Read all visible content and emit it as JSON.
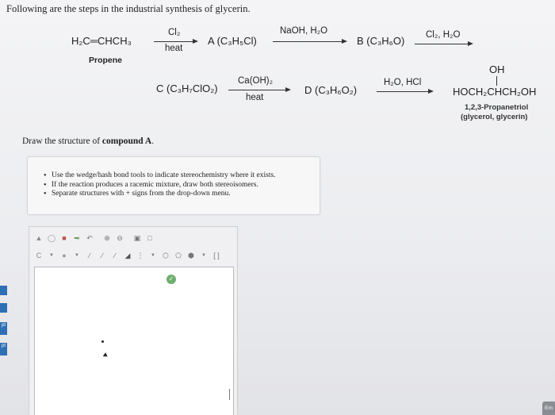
{
  "intro": "Following are the steps in the industrial synthesis of glycerin.",
  "scheme": {
    "propene_formula": "H₂C═CHCH₃",
    "propene_name": "Propene",
    "step1_reagent_top": "Cl₂",
    "step1_reagent_bottom": "heat",
    "compound_a": "A (C₃H₅Cl)",
    "step2_reagent_top": "NaOH, H₂O",
    "compound_b": "B (C₃H₆O)",
    "step3_reagent_top": "Cl₂, H₂O",
    "compound_c": "C (C₃H₇ClO₂)",
    "step4_reagent_top": "Ca(OH)₂",
    "step4_reagent_bottom": "heat",
    "compound_d": "D (C₃H₆O₂)",
    "step5_reagent_top": "H₂O, HCl",
    "glycerol_oh": "OH",
    "glycerol_formula": "HOCH₂CHCH₂OH",
    "glycerol_name_1": "1,2,3-Propanetriol",
    "glycerol_name_2": "(glycerol, glycerin)"
  },
  "prompt": {
    "pre": "Draw the structure of ",
    "bold": "compound A",
    "post": "."
  },
  "instructions": [
    "Use the wedge/hash bond tools to indicate stereochemistry where it exists.",
    "If the reaction produces a racemic mixture, draw both stereoisomers.",
    "Separate structures with + signs from the drop-down menu."
  ],
  "sidebar": {
    "tab1": "pt",
    "tab2": "pt"
  },
  "corner_button": "Em"
}
